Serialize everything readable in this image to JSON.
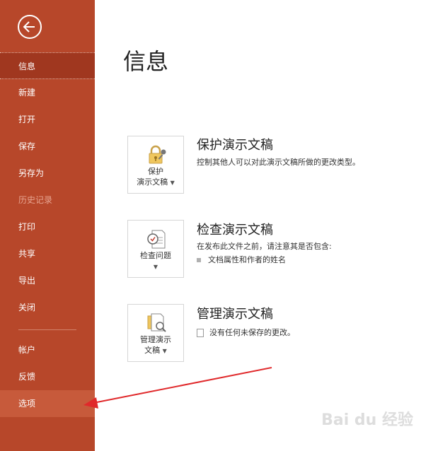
{
  "sidebar": {
    "items": [
      {
        "label": "信息"
      },
      {
        "label": "新建"
      },
      {
        "label": "打开"
      },
      {
        "label": "保存"
      },
      {
        "label": "另存为"
      },
      {
        "label": "历史记录"
      },
      {
        "label": "打印"
      },
      {
        "label": "共享"
      },
      {
        "label": "导出"
      },
      {
        "label": "关闭"
      },
      {
        "label": "帐户"
      },
      {
        "label": "反馈"
      },
      {
        "label": "选项"
      }
    ]
  },
  "main": {
    "title": "信息",
    "sections": [
      {
        "button_line1": "保护",
        "button_line2": "演示文稿",
        "title": "保护演示文稿",
        "description": "控制其他人可以对此演示文稿所做的更改类型。"
      },
      {
        "button_line1": "检查问题",
        "title": "检查演示文稿",
        "description": "在发布此文件之前，请注意其是否包含:",
        "bullet": "文档属性和作者的姓名"
      },
      {
        "button_line1": "管理演示",
        "button_line2": "文稿",
        "title": "管理演示文稿",
        "description": "没有任何未保存的更改。"
      }
    ]
  },
  "watermark": "Bai du 经验",
  "colors": {
    "sidebar": "#b7472a",
    "sidebar_active": "#a0371f",
    "annotation_arrow": "#e0292b"
  }
}
